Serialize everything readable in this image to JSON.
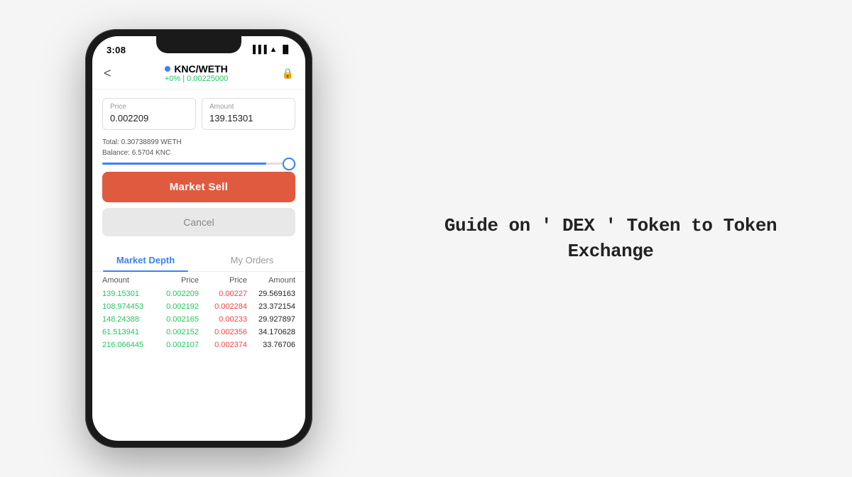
{
  "page": {
    "background": "#f5f5f5"
  },
  "guide_title": "Guide on ' DEX ' Token to Token Exchange",
  "phone": {
    "status_bar": {
      "time": "3:08",
      "icons": "▲ ◀ ▐▐ ⊟"
    },
    "header": {
      "back_label": "<",
      "pair": "KNC/WETH",
      "change": "+0% | 0.00225000",
      "lock_icon": "🔒"
    },
    "form": {
      "price_label": "Price",
      "price_value": "0.002209",
      "amount_label": "Amount",
      "amount_value": "139.15301",
      "total_line1": "Total: 0.30738899 WETH",
      "total_line2": "Balance: 6.5704 KNC",
      "market_sell_label": "Market Sell",
      "cancel_label": "Cancel"
    },
    "tabs": [
      {
        "label": "Market Depth",
        "active": true
      },
      {
        "label": "My Orders",
        "active": false
      }
    ],
    "table": {
      "headers": [
        "Amount",
        "Price",
        "Price",
        "Amount"
      ],
      "rows": [
        {
          "amt_green": "139.15301",
          "price_green": "0.002209",
          "price_red": "0.00227",
          "amt_black": "29.569163"
        },
        {
          "amt_green": "108.974453",
          "price_green": "0.002192",
          "price_red": "0.002284",
          "amt_black": "23.372154"
        },
        {
          "amt_green": "148.24388",
          "price_green": "0.002165",
          "price_red": "0.00233",
          "amt_black": "29.927897"
        },
        {
          "amt_green": "61.513941",
          "price_green": "0.002152",
          "price_red": "0.002356",
          "amt_black": "34.170628"
        },
        {
          "amt_green": "216.066445",
          "price_green": "0.002107",
          "price_red": "0.002374",
          "amt_black": "33.76706"
        }
      ]
    }
  }
}
